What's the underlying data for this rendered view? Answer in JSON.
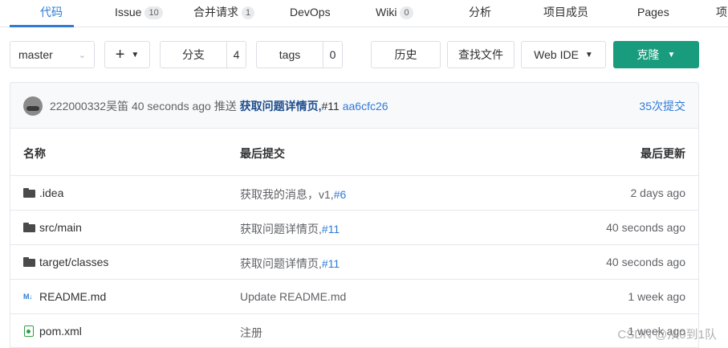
{
  "tabs": [
    {
      "label": "代码",
      "badge": null,
      "active": true
    },
    {
      "label": "Issue",
      "badge": "10",
      "active": false
    },
    {
      "label": "合并请求",
      "badge": "1",
      "active": false
    },
    {
      "label": "DevOps",
      "badge": null,
      "active": false
    },
    {
      "label": "Wiki",
      "badge": "0",
      "active": false
    },
    {
      "label": "分析",
      "badge": null,
      "active": false
    },
    {
      "label": "项目成员",
      "badge": null,
      "active": false
    },
    {
      "label": "Pages",
      "badge": null,
      "active": false
    },
    {
      "label": "项",
      "badge": null,
      "active": false
    }
  ],
  "toolbar": {
    "branch": "master",
    "plus_label": "+",
    "branches_label": "分支",
    "branches_count": "4",
    "tags_label": "tags",
    "tags_count": "0",
    "history_label": "历史",
    "find_file_label": "查找文件",
    "web_ide_label": "Web IDE",
    "clone_label": "克隆"
  },
  "last_commit": {
    "author": "222000332吴笛",
    "time": "40 seconds ago",
    "action": "推送",
    "message": "获取问题详情页,",
    "issue": "#11",
    "sha": "aa6cfc26",
    "commit_count": "35次提交"
  },
  "table": {
    "headers": {
      "name": "名称",
      "last_commit": "最后提交",
      "last_update": "最后更新"
    },
    "rows": [
      {
        "icon": "folder-icon",
        "name": ".idea",
        "message": "获取我的消息，v1,",
        "issue": "#6",
        "time": "2 days ago"
      },
      {
        "icon": "folder-icon",
        "name": "src/main",
        "message": "获取问题详情页,",
        "issue": "#11",
        "time": "40 seconds ago"
      },
      {
        "icon": "folder-icon",
        "name": "target/classes",
        "message": "获取问题详情页,",
        "issue": "#11",
        "time": "40 seconds ago"
      },
      {
        "icon": "markdown-icon",
        "name": "README.md",
        "message": "Update README.md",
        "issue": "",
        "time": "1 week ago"
      },
      {
        "icon": "xml-file-icon",
        "name": "pom.xml",
        "message": "注册",
        "issue": "",
        "time": "1 week ago"
      }
    ]
  },
  "watermark": "CSDN @从0到1队",
  "colors": {
    "accent": "#2f7bd6",
    "clone": "#199c7d",
    "border": "#e4e7ed"
  }
}
